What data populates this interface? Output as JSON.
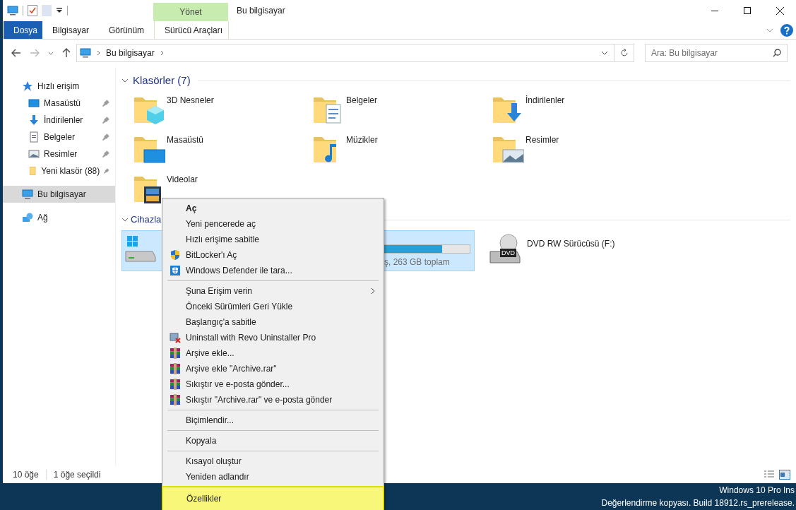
{
  "title_bar": {
    "title": "Bu bilgisayar",
    "context_tab": "Yönet"
  },
  "ribbon": {
    "tabs": [
      {
        "label": "Dosya",
        "kind": "file"
      },
      {
        "label": "Bilgisayar",
        "kind": "tab"
      },
      {
        "label": "Görünüm",
        "kind": "tab"
      },
      {
        "label": "Sürücü Araçları",
        "kind": "context"
      }
    ]
  },
  "address_bar": {
    "path": "Bu bilgisayar",
    "search": {
      "placeholder": "Ara: Bu bilgisayar"
    }
  },
  "sidebar": {
    "items": [
      {
        "label": "Hızlı erişim",
        "kind": "star",
        "selected": false,
        "children": [
          {
            "label": "Masaüstü",
            "kind": "desktop",
            "pinned": true,
            "selected": false
          },
          {
            "label": "İndirilenler",
            "kind": "download",
            "pinned": true,
            "selected": false
          },
          {
            "label": "Belgeler",
            "kind": "document",
            "pinned": true,
            "selected": false
          },
          {
            "label": "Resimler",
            "kind": "pictures",
            "pinned": true,
            "selected": false
          },
          {
            "label": "Yeni klasör (88)",
            "kind": "folder",
            "pinned": true,
            "selected": false
          }
        ]
      },
      {
        "label": "Bu bilgisayar",
        "kind": "pc",
        "selected": true
      },
      {
        "label": "Ağ",
        "kind": "network",
        "selected": false
      }
    ]
  },
  "folders": {
    "heading": "Klasörler (7)",
    "items": [
      {
        "label": "3D Nesneler",
        "kind": "cube"
      },
      {
        "label": "Belgeler",
        "kind": "document"
      },
      {
        "label": "İndirilenler",
        "kind": "download"
      },
      {
        "label": "Masaüstü",
        "kind": "desktop"
      },
      {
        "label": "Müzikler",
        "kind": "music"
      },
      {
        "label": "Resimler",
        "kind": "pictures"
      },
      {
        "label": "Videolar",
        "kind": "video"
      }
    ]
  },
  "devices": {
    "heading": "Cihazla",
    "items": [
      {
        "kind": "disk",
        "selected": true,
        "level": 0.91,
        "detail": "ş, 263 GB toplam"
      },
      {
        "kind": "dvd",
        "selected": false,
        "label": "DVD RW Sürücüsü (F:)",
        "badge": "DVD"
      }
    ]
  },
  "context_menu": {
    "items": [
      {
        "kind": "item",
        "label": "Aç",
        "default": true
      },
      {
        "kind": "item",
        "label": "Yeni pencerede aç"
      },
      {
        "kind": "item",
        "label": "Hızlı erişime sabitle"
      },
      {
        "kind": "shield",
        "label": "BitLocker'ı Aç"
      },
      {
        "kind": "defender",
        "label": "Windows Defender ile tara..."
      },
      {
        "kind": "separator"
      },
      {
        "kind": "submenu",
        "label": "Şuna Erişim verin"
      },
      {
        "kind": "item",
        "label": "Önceki Sürümleri Geri Yükle"
      },
      {
        "kind": "item",
        "label": "Başlangıç'a sabitle"
      },
      {
        "kind": "uninstaller",
        "label": "Uninstall with Revo Uninstaller Pro"
      },
      {
        "kind": "archive",
        "label": "Arşive ekle..."
      },
      {
        "kind": "archive",
        "label": "Arşive ekle \"Archive.rar\""
      },
      {
        "kind": "archive",
        "label": "Sıkıştır ve e-posta gönder..."
      },
      {
        "kind": "archive",
        "label": "Sıkıştır \"Archive.rar\" ve e-posta gönder"
      },
      {
        "kind": "separator"
      },
      {
        "kind": "item",
        "label": "Biçimlendir..."
      },
      {
        "kind": "separator"
      },
      {
        "kind": "item",
        "label": "Kopyala"
      },
      {
        "kind": "separator"
      },
      {
        "kind": "item",
        "label": "Kısayol oluştur"
      },
      {
        "kind": "item",
        "label": "Yeniden adlandır"
      },
      {
        "kind": "separator"
      },
      {
        "kind": "item",
        "label": "Özellikler",
        "highlighted": true
      }
    ]
  },
  "status_bar": {
    "count": "10 öğe",
    "selection": "1 öğe seçildi"
  },
  "desktop": {
    "watermark": [
      "Windows 10 Pro Ins",
      "Değerlendirme kopyası. Build 18912.rs_prerelease."
    ]
  }
}
